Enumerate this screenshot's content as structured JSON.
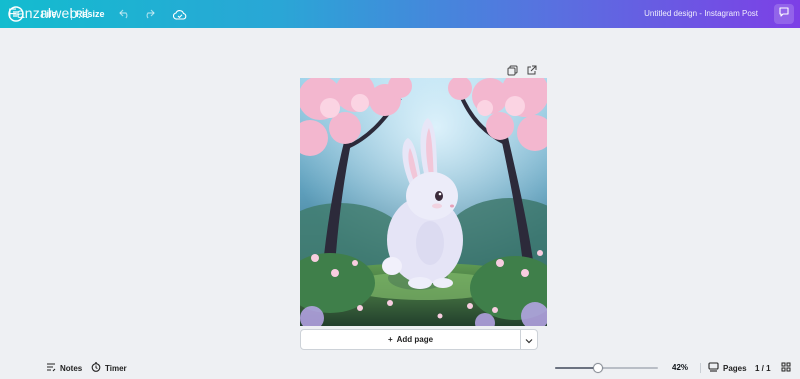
{
  "topbar": {
    "watermark_text": "Fanzalweb.it",
    "menu_file": "File",
    "menu_resize": "Resize",
    "document_title": "Untitled design - Instagram Post",
    "icons": [
      "canva-logo-icon",
      "undo-icon",
      "redo-icon",
      "cloud-save-icon",
      "comment-icon"
    ]
  },
  "canvas": {
    "tool_icons": [
      "duplicate-icon",
      "share-page-icon"
    ],
    "image_subject": "bunny-illustration"
  },
  "add_page": {
    "label": "Add page",
    "plus": "+"
  },
  "footer": {
    "notes_label": "Notes",
    "timer_label": "Timer",
    "zoom_value": "42%",
    "zoom_fraction": 0.42,
    "pages_label": "Pages",
    "page_count": "1 / 1"
  }
}
